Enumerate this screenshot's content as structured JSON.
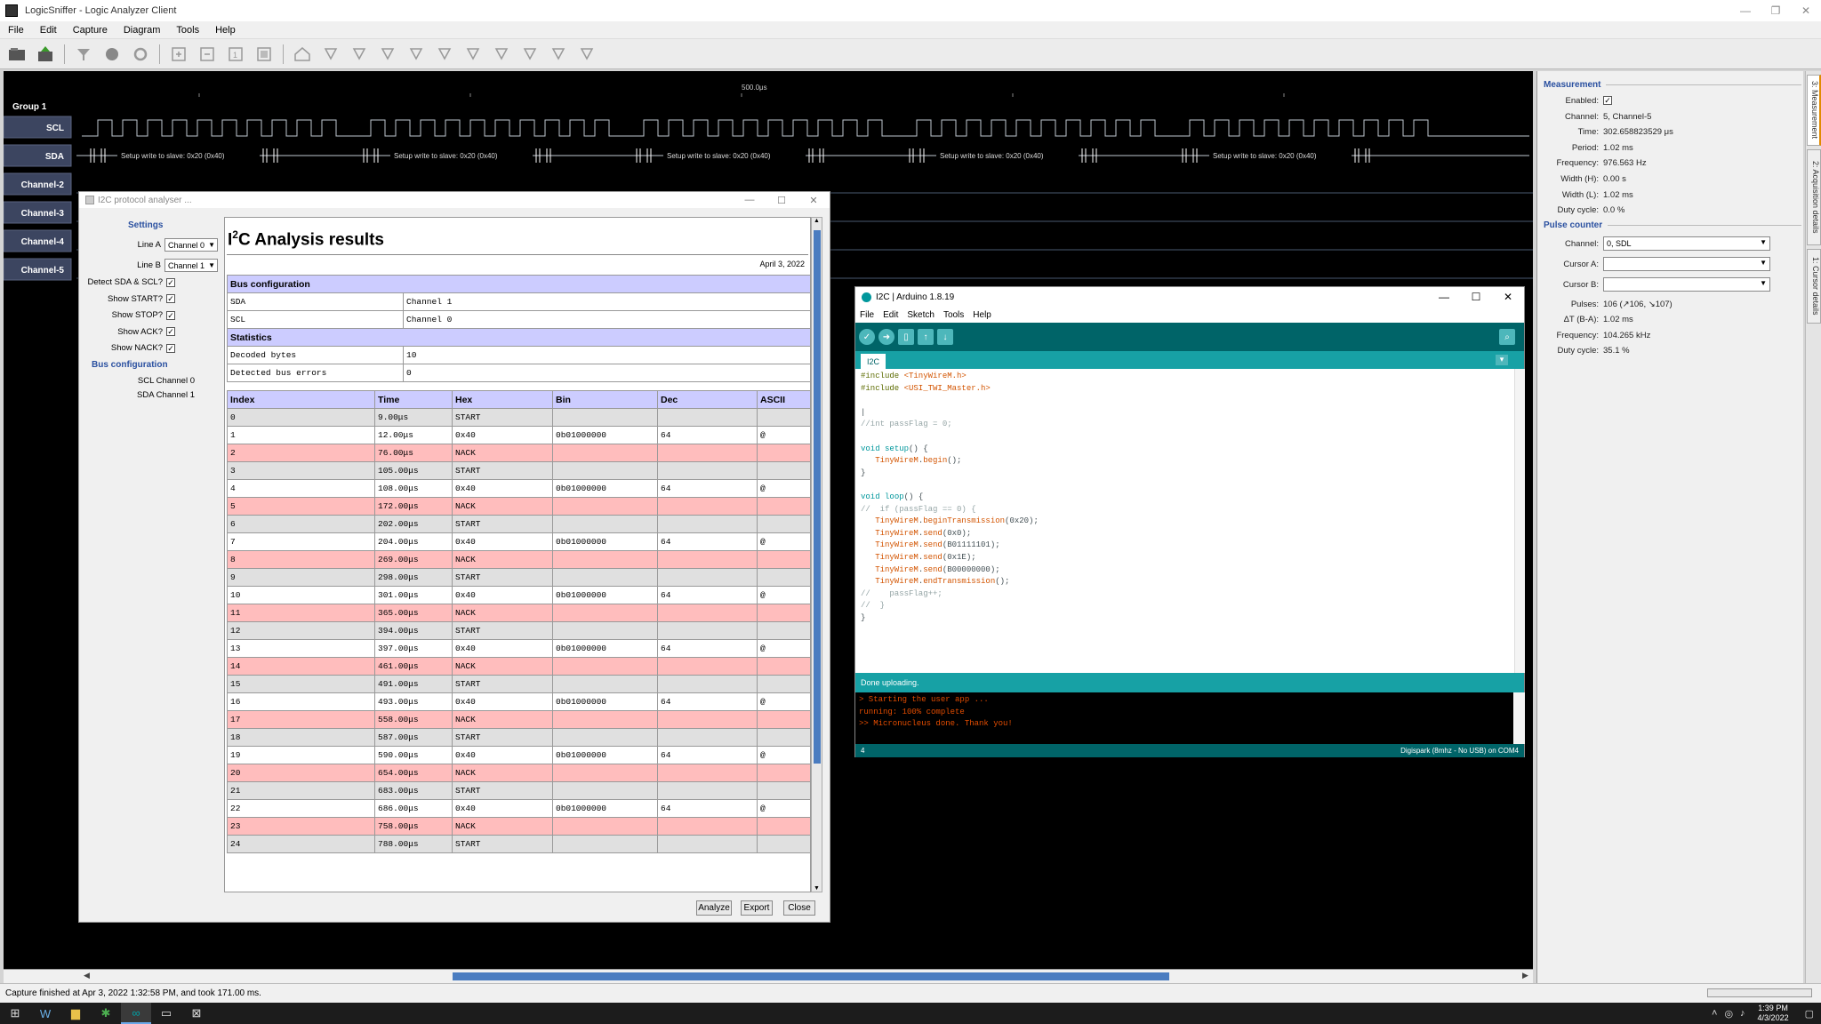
{
  "window": {
    "title": "LogicSniffer - Logic Analyzer Client",
    "controls": [
      "—",
      "❐",
      "✕"
    ]
  },
  "menu": [
    "File",
    "Edit",
    "Capture",
    "Diagram",
    "Tools",
    "Help"
  ],
  "signals": {
    "group_label": "Group 1",
    "timescale_label": "500.0μs",
    "channels": [
      "SCL",
      "SDA",
      "Channel-2",
      "Channel-3",
      "Channel-4",
      "Channel-5"
    ],
    "annotation": "Setup write to slave: 0x20 (0x40)"
  },
  "status_text": "Capture finished at Apr 3, 2022 1:32:58 PM, and took 171.00 ms.",
  "measurement": {
    "section_title": "Measurement",
    "enabled_label": "Enabled:",
    "rows": [
      {
        "label": "Channel:",
        "value": "5, Channel-5"
      },
      {
        "label": "Time:",
        "value": "302.658823529 μs"
      },
      {
        "label": "Period:",
        "value": "1.02 ms"
      },
      {
        "label": "Frequency:",
        "value": "976.563 Hz"
      },
      {
        "label": "Width (H):",
        "value": "0.00 s"
      },
      {
        "label": "Width (L):",
        "value": "1.02 ms"
      },
      {
        "label": "Duty cycle:",
        "value": "0.0 %"
      }
    ],
    "pulse_title": "Pulse counter",
    "pulse_channel_label": "Channel:",
    "pulse_channel_value": "0, SDL",
    "cursor_a_label": "Cursor A:",
    "cursor_b_label": "Cursor B:",
    "pulse_rows": [
      {
        "label": "Pulses:",
        "value": "106 (↗106, ↘107)"
      },
      {
        "label": "ΔT (B-A):",
        "value": "1.02 ms"
      },
      {
        "label": "Frequency:",
        "value": "104.265 kHz"
      },
      {
        "label": "Duty cycle:",
        "value": "35.1 %"
      }
    ],
    "tabs": [
      "3: Measurement",
      "2: Acquisition details",
      "1: Cursor details"
    ]
  },
  "i2c_dialog": {
    "title": "I2C protocol analyser ...",
    "settings_title": "Settings",
    "line_a_label": "Line A",
    "line_a_value": "Channel 0",
    "line_b_label": "Line B",
    "line_b_value": "Channel 1",
    "checks": [
      "Detect SDA & SCL?",
      "Show START?",
      "Show STOP?",
      "Show ACK?",
      "Show NACK?"
    ],
    "bus_title": "Bus configuration",
    "bus_scl": "SCL  Channel 0",
    "bus_sda": "SDA  Channel 1",
    "results_heading_pre": "I",
    "results_heading_sup": "2",
    "results_heading_post": "C Analysis results",
    "date": "April 3, 2022",
    "bus_config_header": "Bus configuration",
    "bus_config_rows": [
      [
        "SDA",
        "Channel 1"
      ],
      [
        "SCL",
        "Channel 0"
      ]
    ],
    "statistics_header": "Statistics",
    "statistics_rows": [
      [
        "Decoded bytes",
        "10"
      ],
      [
        "Detected bus errors",
        "0"
      ]
    ],
    "columns": [
      "Index",
      "Time",
      "Hex",
      "Bin",
      "Dec",
      "ASCII"
    ],
    "rows": [
      [
        "0",
        "9.00μs",
        "START",
        "",
        "",
        ""
      ],
      [
        "1",
        "12.00μs",
        "0x40",
        "0b01000000",
        "64",
        "@"
      ],
      [
        "2",
        "76.00μs",
        "NACK",
        "",
        "",
        ""
      ],
      [
        "3",
        "105.00μs",
        "START",
        "",
        "",
        ""
      ],
      [
        "4",
        "108.00μs",
        "0x40",
        "0b01000000",
        "64",
        "@"
      ],
      [
        "5",
        "172.00μs",
        "NACK",
        "",
        "",
        ""
      ],
      [
        "6",
        "202.00μs",
        "START",
        "",
        "",
        ""
      ],
      [
        "7",
        "204.00μs",
        "0x40",
        "0b01000000",
        "64",
        "@"
      ],
      [
        "8",
        "269.00μs",
        "NACK",
        "",
        "",
        ""
      ],
      [
        "9",
        "298.00μs",
        "START",
        "",
        "",
        ""
      ],
      [
        "10",
        "301.00μs",
        "0x40",
        "0b01000000",
        "64",
        "@"
      ],
      [
        "11",
        "365.00μs",
        "NACK",
        "",
        "",
        ""
      ],
      [
        "12",
        "394.00μs",
        "START",
        "",
        "",
        ""
      ],
      [
        "13",
        "397.00μs",
        "0x40",
        "0b01000000",
        "64",
        "@"
      ],
      [
        "14",
        "461.00μs",
        "NACK",
        "",
        "",
        ""
      ],
      [
        "15",
        "491.00μs",
        "START",
        "",
        "",
        ""
      ],
      [
        "16",
        "493.00μs",
        "0x40",
        "0b01000000",
        "64",
        "@"
      ],
      [
        "17",
        "558.00μs",
        "NACK",
        "",
        "",
        ""
      ],
      [
        "18",
        "587.00μs",
        "START",
        "",
        "",
        ""
      ],
      [
        "19",
        "590.00μs",
        "0x40",
        "0b01000000",
        "64",
        "@"
      ],
      [
        "20",
        "654.00μs",
        "NACK",
        "",
        "",
        ""
      ],
      [
        "21",
        "683.00μs",
        "START",
        "",
        "",
        ""
      ],
      [
        "22",
        "686.00μs",
        "0x40",
        "0b01000000",
        "64",
        "@"
      ],
      [
        "23",
        "758.00μs",
        "NACK",
        "",
        "",
        ""
      ],
      [
        "24",
        "788.00μs",
        "START",
        "",
        "",
        ""
      ]
    ],
    "buttons": {
      "analyze": "Analyze",
      "export": "Export",
      "close": "Close"
    }
  },
  "arduino": {
    "title": "I2C | Arduino 1.8.19",
    "menu": [
      "File",
      "Edit",
      "Sketch",
      "Tools",
      "Help"
    ],
    "tab": "I2C",
    "code": [
      [
        [
          "kw-inc",
          "#include "
        ],
        [
          "kw-lib",
          "<TinyWireM.h>"
        ]
      ],
      [
        [
          "kw-inc",
          "#include "
        ],
        [
          "kw-lib",
          "<USI_TWI_Master.h>"
        ]
      ],
      [
        [
          "",
          ""
        ]
      ],
      [
        [
          "",
          "|"
        ]
      ],
      [
        [
          "kw-com",
          "//int passFlag = 0;"
        ]
      ],
      [
        [
          "",
          ""
        ]
      ],
      [
        [
          "kw-type",
          "void "
        ],
        [
          "kw-type",
          "setup"
        ],
        [
          "",
          "() {"
        ]
      ],
      [
        [
          "",
          "   "
        ],
        [
          "kw-lib",
          "TinyWireM"
        ],
        [
          "",
          "."
        ],
        [
          "kw-lib",
          "begin"
        ],
        [
          "",
          "();"
        ]
      ],
      [
        [
          "",
          "}"
        ]
      ],
      [
        [
          "",
          ""
        ]
      ],
      [
        [
          "kw-type",
          "void "
        ],
        [
          "kw-type",
          "loop"
        ],
        [
          "",
          "() {"
        ]
      ],
      [
        [
          "kw-com",
          "//  if (passFlag == 0) {"
        ]
      ],
      [
        [
          "",
          "   "
        ],
        [
          "kw-lib",
          "TinyWireM"
        ],
        [
          "",
          "."
        ],
        [
          "kw-lib",
          "beginTransmission"
        ],
        [
          "",
          "(0x20);"
        ]
      ],
      [
        [
          "",
          "   "
        ],
        [
          "kw-lib",
          "TinyWireM"
        ],
        [
          "",
          "."
        ],
        [
          "kw-lib",
          "send"
        ],
        [
          "",
          "(0x0);"
        ]
      ],
      [
        [
          "",
          "   "
        ],
        [
          "kw-lib",
          "TinyWireM"
        ],
        [
          "",
          "."
        ],
        [
          "kw-lib",
          "send"
        ],
        [
          "",
          "(B01111101);"
        ]
      ],
      [
        [
          "",
          "   "
        ],
        [
          "kw-lib",
          "TinyWireM"
        ],
        [
          "",
          "."
        ],
        [
          "kw-lib",
          "send"
        ],
        [
          "",
          "(0x1E);"
        ]
      ],
      [
        [
          "",
          "   "
        ],
        [
          "kw-lib",
          "TinyWireM"
        ],
        [
          "",
          "."
        ],
        [
          "kw-lib",
          "send"
        ],
        [
          "",
          "(B00000000);"
        ]
      ],
      [
        [
          "",
          "   "
        ],
        [
          "kw-lib",
          "TinyWireM"
        ],
        [
          "",
          "."
        ],
        [
          "kw-lib",
          "endTransmission"
        ],
        [
          "",
          "();"
        ]
      ],
      [
        [
          "kw-com",
          "//    passFlag++;"
        ]
      ],
      [
        [
          "kw-com",
          "//  }"
        ]
      ],
      [
        [
          "",
          "}"
        ]
      ]
    ],
    "status": "Done uploading.",
    "console": [
      "> Starting the user app ...",
      "running: 100% complete",
      ">> Micronucleus done. Thank you!"
    ],
    "line_number": "4",
    "board": "Digispark (8mhz - No USB) on COM4"
  },
  "taskbar": {
    "time": "1:39 PM",
    "date": "4/3/2022"
  }
}
